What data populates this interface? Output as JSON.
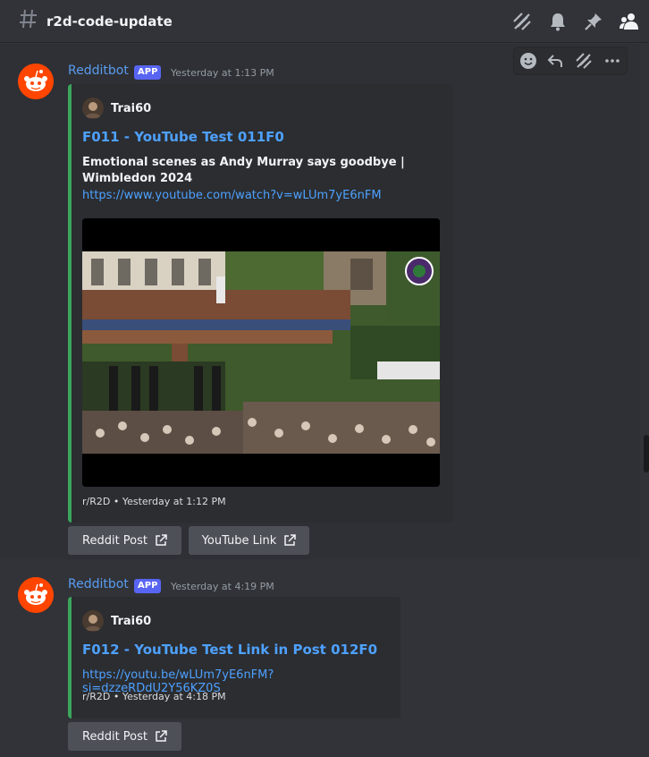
{
  "header": {
    "channel_name": "r2d-code-update",
    "icons": [
      "threads-icon",
      "bell-icon",
      "pin-icon",
      "members-icon"
    ]
  },
  "hover_toolbar": {
    "icons": [
      "emoji-icon",
      "reply-icon",
      "thread-icon",
      "more-icon"
    ]
  },
  "messages": [
    {
      "author": "Redditbot",
      "badge": "APP",
      "timestamp": "Yesterday at 1:13 PM",
      "embed": {
        "author_name": "Trai60",
        "title": "F011 - YouTube Test 011F0",
        "description": "Emotional scenes as Andy Murray says goodbye | Wimbledon 2024",
        "link": "https://www.youtube.com/watch?v=wLUm7yE6nFM",
        "footer": "r/R2D • Yesterday at 1:12 PM",
        "accent": "#3ba55c"
      },
      "buttons": [
        {
          "label": "Reddit Post"
        },
        {
          "label": "YouTube Link"
        }
      ]
    },
    {
      "author": "Redditbot",
      "badge": "APP",
      "timestamp": "Yesterday at 4:19 PM",
      "embed": {
        "author_name": "Trai60",
        "title": "F012 - YouTube Test Link in Post 012F0",
        "link": "https://youtu.be/wLUm7yE6nFM?si=dzzeRDdU2Y56KZ0S",
        "footer": "r/R2D • Yesterday at 4:18 PM",
        "accent": "#3ba55c"
      },
      "buttons": [
        {
          "label": "Reddit Post"
        }
      ]
    }
  ],
  "colors": {
    "background": "#313338",
    "link": "#4ea1ff",
    "username": "#5a9cf0",
    "badge": "#5865f2",
    "reddit": "#ff4500"
  }
}
